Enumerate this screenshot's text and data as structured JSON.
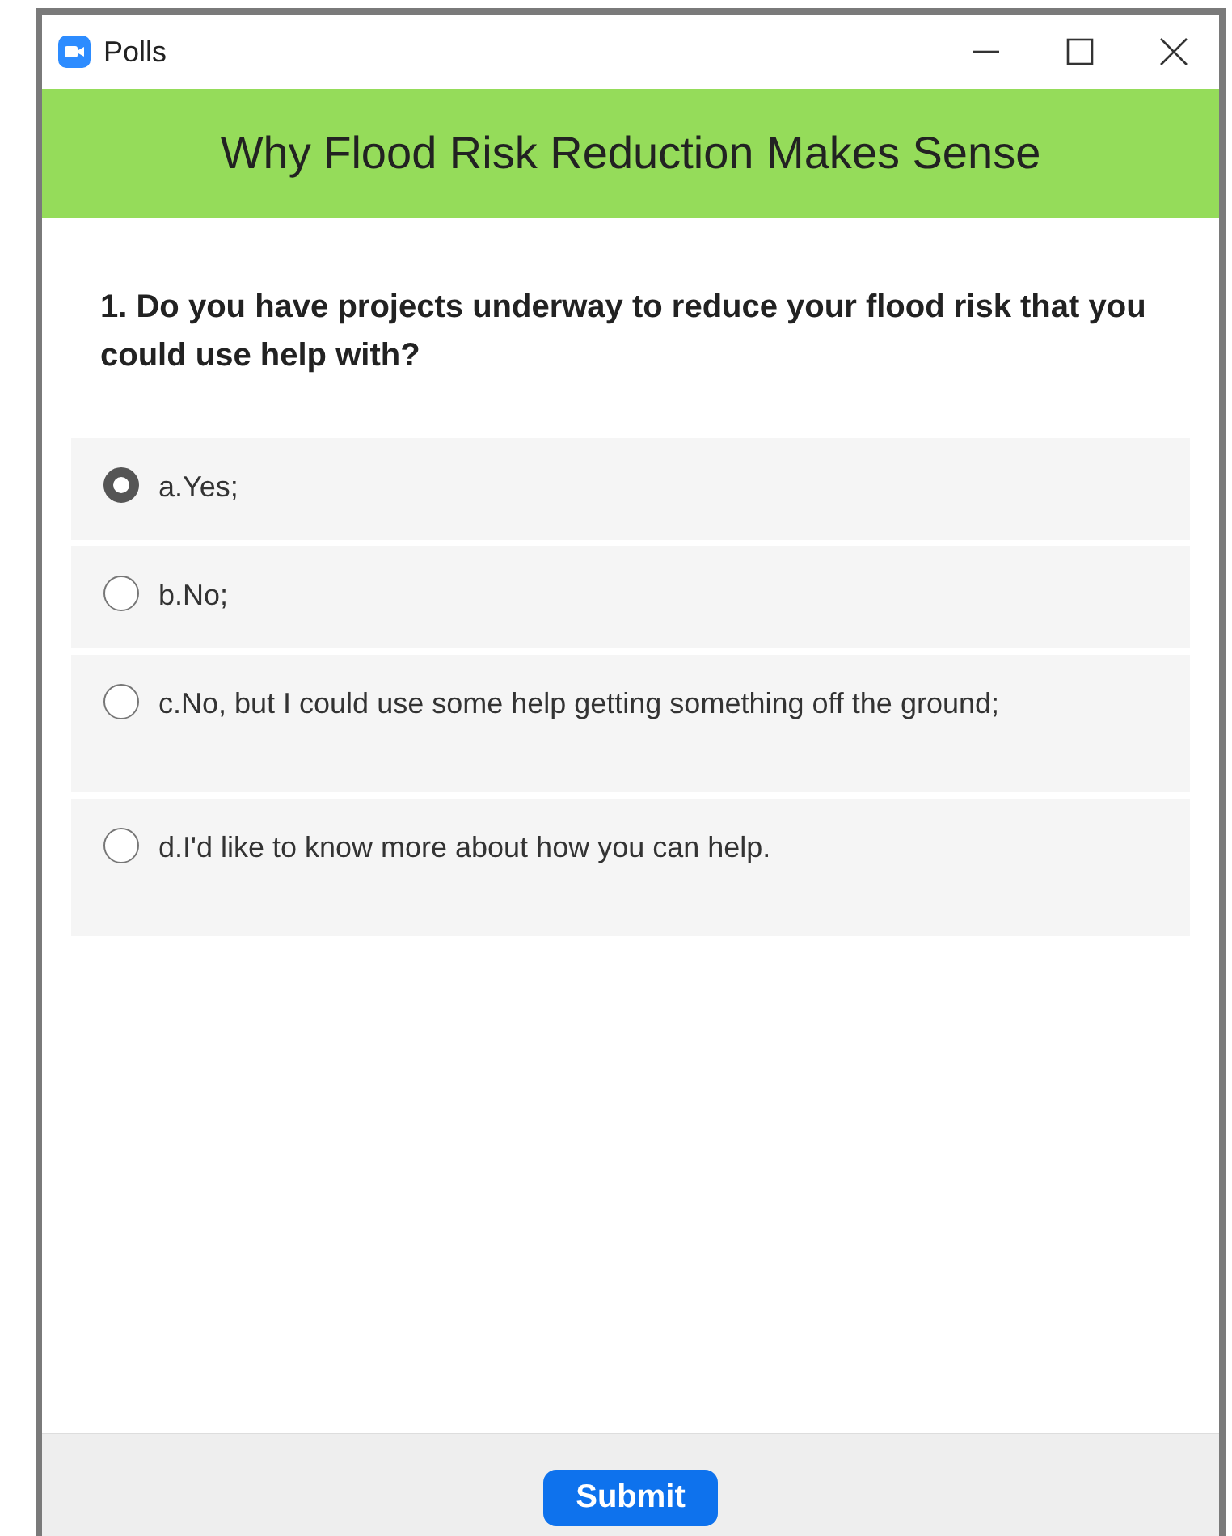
{
  "window": {
    "title": "Polls"
  },
  "poll": {
    "title": "Why Flood Risk Reduction Makes Sense",
    "question": "1. Do you have projects underway to reduce your flood risk that you could use help with?",
    "options": [
      {
        "label": "a.Yes;",
        "selected": true
      },
      {
        "label": "b.No;",
        "selected": false
      },
      {
        "label": "c.No, but I could use some help getting something off the ground;",
        "selected": false
      },
      {
        "label": "d.I'd like to know more about how you can help.",
        "selected": false
      }
    ]
  },
  "buttons": [
    "Submit"
  ]
}
